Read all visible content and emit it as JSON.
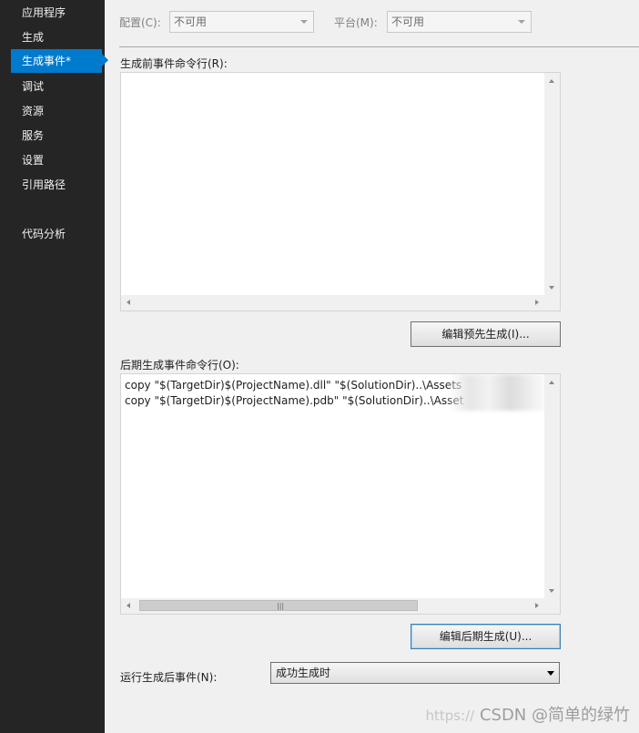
{
  "sidebar": {
    "items": [
      {
        "label": "应用程序"
      },
      {
        "label": "生成"
      },
      {
        "label": "生成事件*"
      },
      {
        "label": "调试"
      },
      {
        "label": "资源"
      },
      {
        "label": "服务"
      },
      {
        "label": "设置"
      },
      {
        "label": "引用路径"
      },
      {
        "label": "代码分析"
      }
    ],
    "active_index": 2
  },
  "config": {
    "configuration_label": "配置(C):",
    "configuration_value": "不可用",
    "platform_label": "平台(M):",
    "platform_value": "不可用"
  },
  "prebuild": {
    "label": "生成前事件命令行(R):",
    "content": "",
    "edit_button": "编辑预先生成(I)..."
  },
  "postbuild": {
    "label": "后期生成事件命令行(O):",
    "lines": [
      "copy \"$(TargetDir)$(ProjectName).dll\" \"$(SolutionDir)..\\Assets",
      "copy \"$(TargetDir)$(ProjectName).pdb\" \"$(SolutionDir)..\\Asset"
    ],
    "edit_button": "编辑后期生成(U)..."
  },
  "run_postbuild": {
    "label": "运行生成后事件(N):",
    "value": "成功生成时"
  },
  "watermark": {
    "faint": "https://",
    "text": "CSDN @简单的绿竹"
  },
  "icons": [
    "up-arrow-icon",
    "down-arrow-icon",
    "left-arrow-icon",
    "right-arrow-icon",
    "dropdown-arrow-icon",
    "grip-icon"
  ]
}
